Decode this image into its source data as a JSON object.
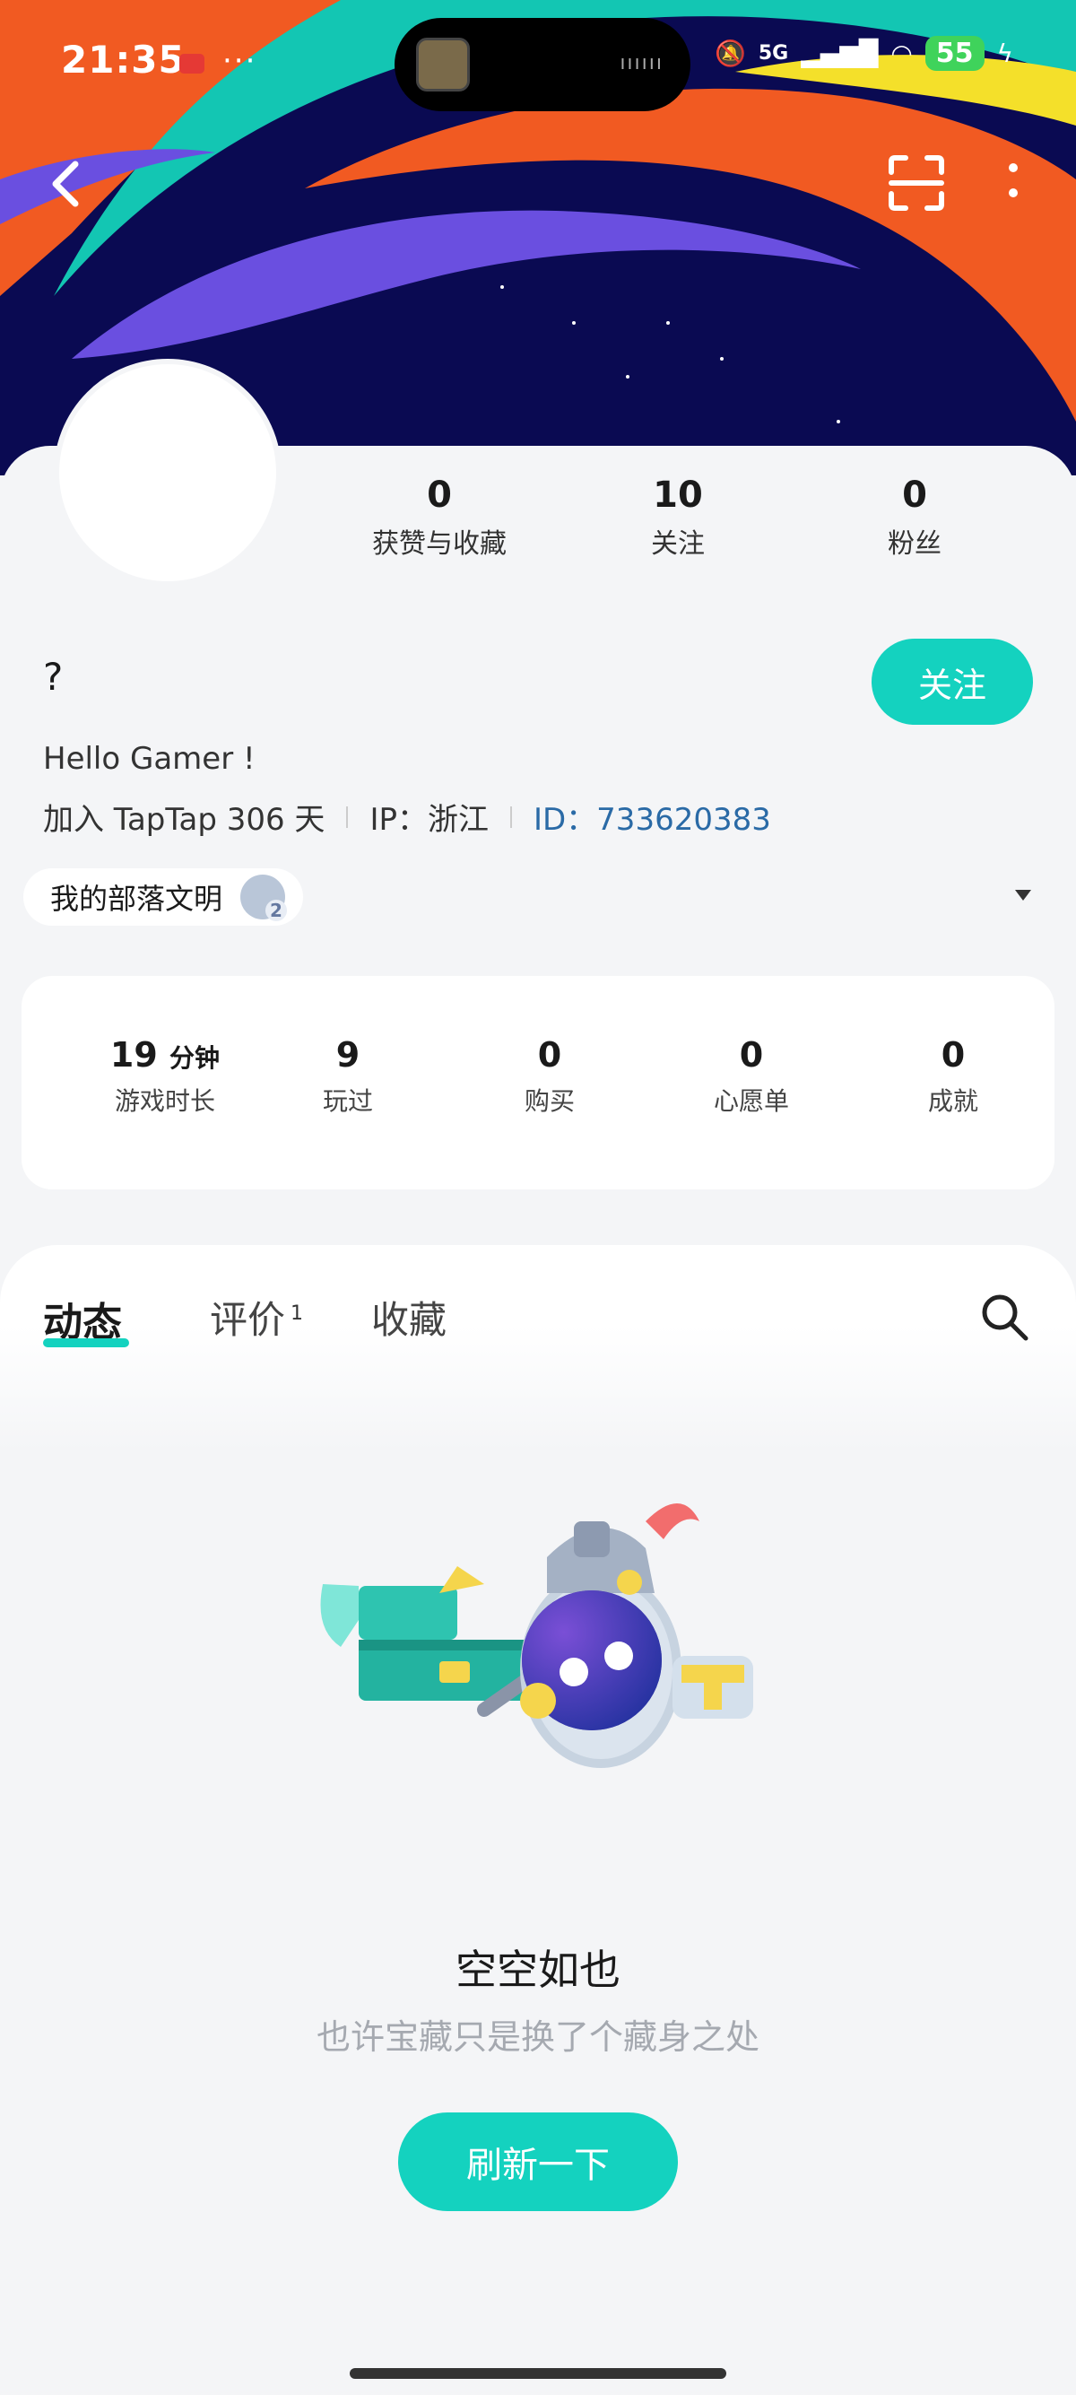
{
  "status_bar": {
    "time": "21:35",
    "more": "···",
    "battery": "55",
    "network": "5G"
  },
  "stats": [
    {
      "value": "0",
      "label": "获赞与收藏"
    },
    {
      "value": "10",
      "label": "关注"
    },
    {
      "value": "0",
      "label": "粉丝"
    }
  ],
  "user": {
    "name": "?",
    "bio": "Hello Gamer !",
    "joined": "加入 TapTap 306 天",
    "ip": "IP：浙江",
    "id": "ID：733620383"
  },
  "follow_label": "关注",
  "tribe": {
    "label": "我的部落文明",
    "badge_level": "2"
  },
  "game_stats": [
    {
      "value": "19",
      "unit": "分钟",
      "label": "游戏时长"
    },
    {
      "value": "9",
      "label": "玩过"
    },
    {
      "value": "0",
      "label": "购买"
    },
    {
      "value": "0",
      "label": "心愿单"
    },
    {
      "value": "0",
      "label": "成就"
    }
  ],
  "tabs": [
    {
      "label": "动态",
      "active": true
    },
    {
      "label": "评价",
      "count": "1"
    },
    {
      "label": "收藏"
    }
  ],
  "empty": {
    "title": "空空如也",
    "subtitle": "也许宝藏只是换了个藏身之处",
    "refresh_label": "刷新一下"
  },
  "colors": {
    "accent": "#14d2bf",
    "id_link": "#2a6aa6",
    "banner_bg": "#0a0a52"
  },
  "icons": [
    "back-icon",
    "scan-icon",
    "more-icon",
    "search-icon",
    "chevron-down-icon"
  ]
}
